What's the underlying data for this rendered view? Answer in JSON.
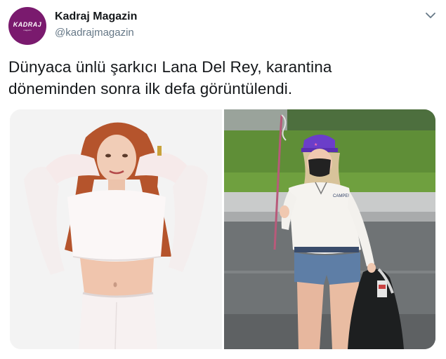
{
  "account": {
    "name": "Kadraj Magazin",
    "handle": "@kadrajmagazin",
    "avatar_logo": "KADRAJ",
    "avatar_logo_sub": "magazin"
  },
  "tweet": {
    "text_line1": "Dünyaca ünlü şarkıcı Lana Del Rey, karantina",
    "text_line2": "döneminden sonra ilk defa görüntülendi."
  },
  "media": {
    "photo_left_icon": "photo-woman-white-outfit",
    "photo_right_icon": "photo-woman-street-mask",
    "cap_text": "CAMPER"
  },
  "icons": {
    "menu": "chevron-down-icon"
  },
  "colors": {
    "brand": "#7a1a6e",
    "name": "#14171a",
    "handle": "#657786"
  }
}
